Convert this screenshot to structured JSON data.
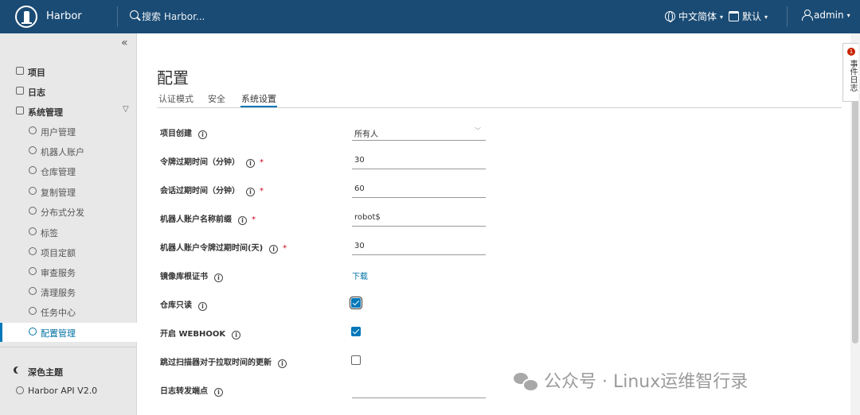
{
  "header": {
    "brand": "Harbor",
    "search_placeholder": "搜索 Harbor...",
    "language": "中文简体",
    "datetime_format": "默认",
    "user": "admin"
  },
  "sidebar": {
    "collapse_glyph": "«",
    "items": [
      {
        "label": "项目",
        "icon": "projects-icon"
      },
      {
        "label": "日志",
        "icon": "logs-icon"
      },
      {
        "label": "系统管理",
        "icon": "admin-icon"
      },
      {
        "label": "用户管理",
        "icon": "users-icon"
      },
      {
        "label": "机器人账户",
        "icon": "robot-icon"
      },
      {
        "label": "仓库管理",
        "icon": "registry-icon"
      },
      {
        "label": "复制管理",
        "icon": "replication-icon"
      },
      {
        "label": "分布式分发",
        "icon": "distribution-icon"
      },
      {
        "label": "标签",
        "icon": "tag-icon"
      },
      {
        "label": "项目定额",
        "icon": "quota-icon"
      },
      {
        "label": "审查服务",
        "icon": "shield-icon"
      },
      {
        "label": "清理服务",
        "icon": "trash-icon"
      },
      {
        "label": "任务中心",
        "icon": "dashboard-icon"
      },
      {
        "label": "配置管理",
        "icon": "gear-icon"
      }
    ],
    "dark_theme": "深色主题",
    "api": "Harbor API V2.0"
  },
  "main": {
    "title": "配置",
    "tabs": [
      "认证模式",
      "安全",
      "系统设置"
    ],
    "active_tab": "系统设置",
    "settings": [
      {
        "label": "项目创建",
        "type": "select",
        "value": "所有人",
        "required": false
      },
      {
        "label": "令牌过期时间（分钟）",
        "type": "input",
        "value": "30",
        "required": true
      },
      {
        "label": "会话过期时间（分钟）",
        "type": "input",
        "value": "60",
        "required": true
      },
      {
        "label": "机器人账户名称前缀",
        "type": "input",
        "value": "robot$",
        "required": true
      },
      {
        "label": "机器人账户令牌过期时间(天)",
        "type": "input",
        "value": "30",
        "required": true
      },
      {
        "label": "镜像库根证书",
        "type": "link",
        "value": "下载",
        "required": false
      },
      {
        "label": "仓库只读",
        "type": "checkbox",
        "checked": true,
        "required": false
      },
      {
        "label": "开启 WEBHOOK",
        "type": "checkbox",
        "checked": true,
        "required": false
      },
      {
        "label": "跳过扫描器对于拉取时间的更新",
        "type": "checkbox",
        "checked": false,
        "required": false
      },
      {
        "label": "日志转发端点",
        "type": "input",
        "value": "",
        "required": false
      }
    ],
    "required_mark": "*",
    "info_glyph": "i"
  },
  "event_log": {
    "label": "事件日志",
    "count": "1"
  },
  "watermark": "公众号 · Linux运维智行录",
  "colors": {
    "header_bg": "#1a4b74",
    "accent": "#0077b8",
    "required": "#d0021b"
  }
}
